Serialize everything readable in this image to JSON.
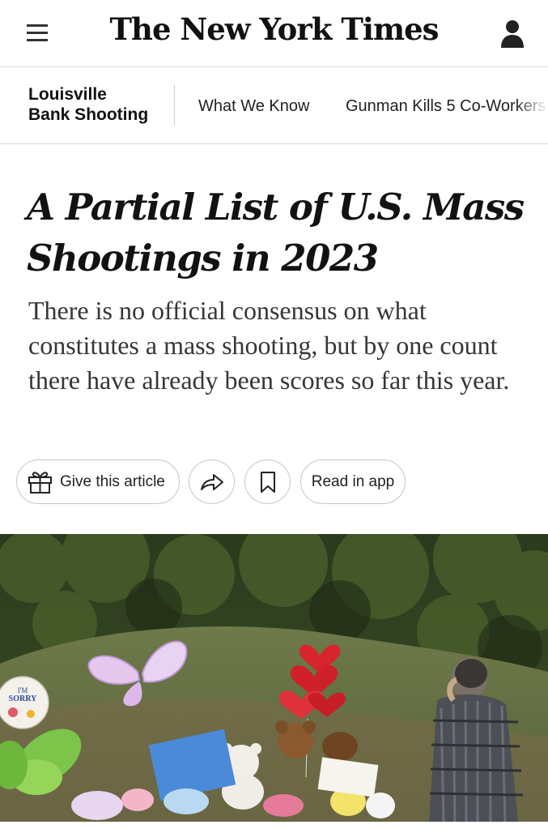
{
  "header": {
    "logo_text": "The New York Times"
  },
  "subnav": {
    "title_line1": "Louisville",
    "title_line2": "Bank Shooting",
    "links": [
      "What We Know",
      "Gunman Kills 5 Co-Workers"
    ]
  },
  "article": {
    "headline": "A Partial List of U.S. Mass Shootings in 2023",
    "summary": "There is no official consensus on what constitutes a mass shooting, but by one count there have already been scores so far this year."
  },
  "actions": {
    "gift_label": "Give this article",
    "read_in_app_label": "Read in app"
  },
  "photo": {
    "balloon_text_line1": "I'M",
    "balloon_text_line2": "SORRY"
  },
  "icons": [
    "hamburger-menu-icon",
    "account-icon",
    "gift-icon",
    "share-icon",
    "bookmark-icon"
  ]
}
